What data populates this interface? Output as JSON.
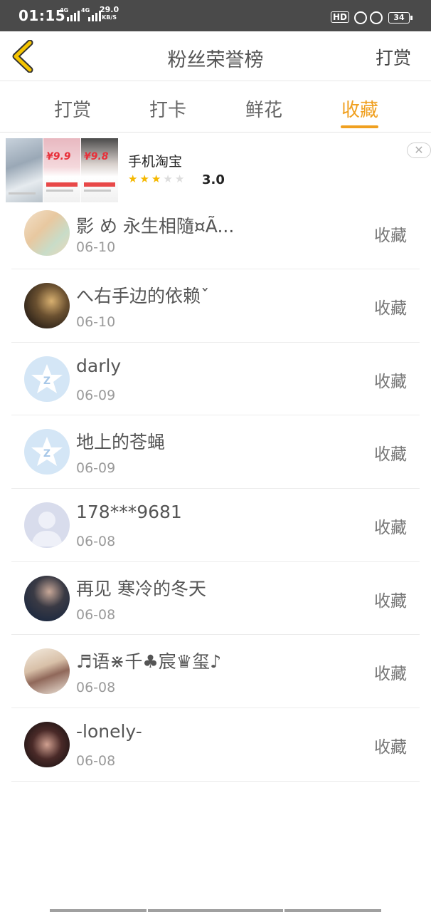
{
  "status_bar": {
    "time": "01:15",
    "signal_1_label": "4G",
    "signal_2_label": "4G",
    "speed_value": "29.0",
    "speed_unit": "KB/S",
    "hd_label": "HD",
    "battery": "34"
  },
  "header": {
    "title": "粉丝荣誉榜",
    "right_action": "打赏"
  },
  "tabs": [
    {
      "label": "打赏",
      "active": false
    },
    {
      "label": "打卡",
      "active": false
    },
    {
      "label": "鲜花",
      "active": false
    },
    {
      "label": "收藏",
      "active": true
    }
  ],
  "ad": {
    "app_name": "手机淘宝",
    "rating": "3.0",
    "rating_value": 3,
    "rating_max": 5,
    "thumb_prices": [
      "¥9.9",
      "¥9.8"
    ]
  },
  "list": [
    {
      "name": "影 め 永生相隨¤Ã...",
      "date": "06-10",
      "action": "收藏"
    },
    {
      "name": "へ右手边的依赖ˇ",
      "date": "06-10",
      "action": "收藏"
    },
    {
      "name": "darly",
      "date": "06-09",
      "action": "收藏"
    },
    {
      "name": "地上的苍蝇",
      "date": "06-09",
      "action": "收藏"
    },
    {
      "name": "178***9681",
      "date": "06-08",
      "action": "收藏"
    },
    {
      "name": "再见 寒冷的冬天",
      "date": "06-08",
      "action": "收藏"
    },
    {
      "name": "♬语⋇千♣宸♛玺♪",
      "date": "06-08",
      "action": "收藏"
    },
    {
      "name": "-lonely-",
      "date": "06-08",
      "action": "收藏"
    }
  ],
  "colors": {
    "accent": "#f0a020",
    "status_bar": "#4a4a4a",
    "star_on": "#f5b800"
  }
}
